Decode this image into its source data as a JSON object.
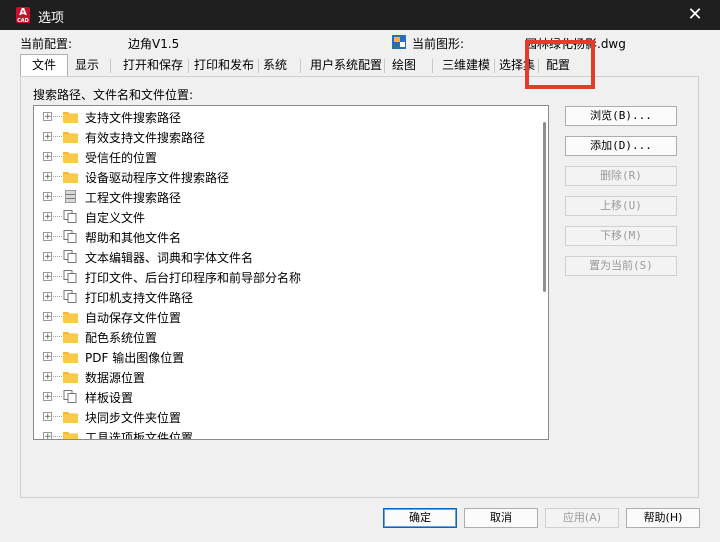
{
  "window": {
    "title": "选项"
  },
  "profile": {
    "current_profile_label": "当前配置:",
    "current_profile_value": "边角V1.5",
    "current_drawing_label": "当前图形:",
    "current_drawing_value": "园林绿化扬影.dwg"
  },
  "tabs": [
    "文件",
    "显示",
    "打开和保存",
    "打印和发布",
    "系统",
    "用户系统配置",
    "绘图",
    "三维建模",
    "选择集",
    "配置"
  ],
  "active_tab": "文件",
  "files": {
    "section_label": "搜索路径、文件名和文件位置:",
    "tree_items": [
      {
        "label": "支持文件搜索路径",
        "icon": "folder-icon"
      },
      {
        "label": "有效支持文件搜索路径",
        "icon": "folder-icon"
      },
      {
        "label": "受信任的位置",
        "icon": "folder-icon"
      },
      {
        "label": "设备驱动程序文件搜索路径",
        "icon": "folder-icon"
      },
      {
        "label": "工程文件搜索路径",
        "icon": "cabinet-icon"
      },
      {
        "label": "自定义文件",
        "icon": "documents-icon"
      },
      {
        "label": "帮助和其他文件名",
        "icon": "documents-icon"
      },
      {
        "label": "文本编辑器、词典和字体文件名",
        "icon": "documents-icon"
      },
      {
        "label": "打印文件、后台打印程序和前导部分名称",
        "icon": "documents-icon"
      },
      {
        "label": "打印机支持文件路径",
        "icon": "documents-icon"
      },
      {
        "label": "自动保存文件位置",
        "icon": "folder-icon"
      },
      {
        "label": "配色系统位置",
        "icon": "folder-icon"
      },
      {
        "label": "PDF 输出图像位置",
        "icon": "folder-icon"
      },
      {
        "label": "数据源位置",
        "icon": "folder-icon"
      },
      {
        "label": "样板设置",
        "icon": "documents-icon"
      },
      {
        "label": "块同步文件夹位置",
        "icon": "folder-icon"
      },
      {
        "label": "工具选项板文件位置",
        "icon": "folder-icon"
      }
    ]
  },
  "side_buttons": {
    "browse": "浏览(B)...",
    "add": "添加(D)...",
    "remove": "删除(R)",
    "move_up": "上移(U)",
    "move_down": "下移(M)",
    "set_current": "置为当前(S)"
  },
  "bottom_buttons": {
    "ok": "确定",
    "cancel": "取消",
    "apply": "应用(A)",
    "help": "帮助(H)"
  },
  "colors": {
    "highlight": "#e8392b",
    "folder": "#f5b82e",
    "titlebar": "#1f1f1f"
  }
}
